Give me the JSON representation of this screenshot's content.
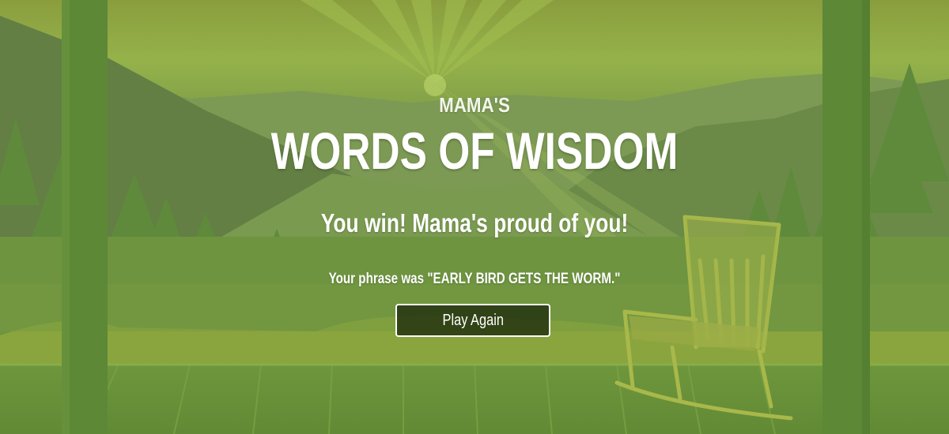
{
  "header": {
    "subtitle": "MAMA'S",
    "title": "WORDS OF WISDOM"
  },
  "result": {
    "message": "You win! Mama's proud of you!",
    "phrase_prefix": "Your phrase was ",
    "phrase": "\"EARLY BIRD GETS THE WORM.\""
  },
  "actions": {
    "play_again_label": "Play Again"
  },
  "colors": {
    "sky": "#8fae45",
    "overlay_green": "#6b8e3e",
    "button_bg": "#1e2a0c",
    "text": "#ffffff"
  }
}
